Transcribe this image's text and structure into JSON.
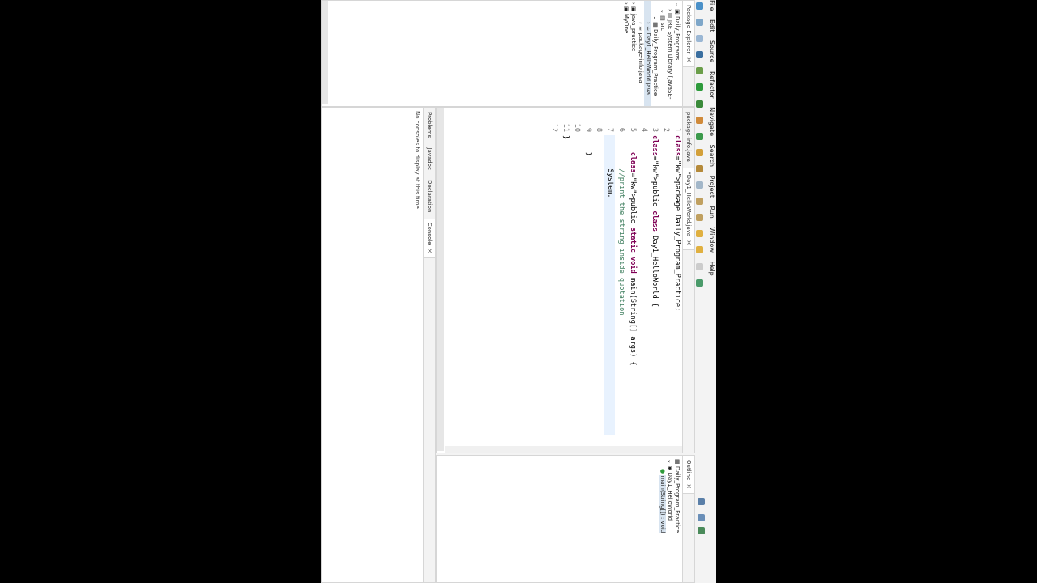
{
  "menu": [
    "File",
    "Edit",
    "Source",
    "Refactor",
    "Navigate",
    "Search",
    "Project",
    "Run",
    "Window",
    "Help"
  ],
  "package_explorer": {
    "title": "Package Explorer",
    "items": [
      {
        "label": "Daily_Programs",
        "indent": 0
      },
      {
        "label": "JRE System Library [JavaSE-",
        "indent": 1
      },
      {
        "label": "src",
        "indent": 1
      },
      {
        "label": "Daily_Program_Practice",
        "indent": 2
      },
      {
        "label": "Day1_HelloWorld.java",
        "indent": 3
      },
      {
        "label": "package-info.java",
        "indent": 3
      },
      {
        "label": "java_practice",
        "indent": 0
      },
      {
        "label": "MyOne",
        "indent": 0
      }
    ]
  },
  "editor": {
    "tabs": [
      "package-info.java",
      "*Day1_HelloWorld.java"
    ],
    "lines": [
      {
        "n": "1",
        "t": "package Daily_Program_Practice;"
      },
      {
        "n": "2",
        "t": ""
      },
      {
        "n": "3",
        "t": "public class Day1_HelloWorld {"
      },
      {
        "n": "4",
        "t": ""
      },
      {
        "n": "5",
        "t": "    public static void main(String[] args) {"
      },
      {
        "n": "6",
        "t": "        //print the string inside quotation"
      },
      {
        "n": "7",
        "t": "        System."
      },
      {
        "n": "8",
        "t": ""
      },
      {
        "n": "9",
        "t": "    }"
      },
      {
        "n": "10",
        "t": ""
      },
      {
        "n": "11",
        "t": "}"
      },
      {
        "n": "12",
        "t": ""
      }
    ]
  },
  "outline": {
    "title": "Outline",
    "items": [
      "Daily_Program_Practice",
      "Day1_HelloWorld",
      "main(String[]) : void"
    ]
  },
  "bottom_panel": {
    "tabs": [
      "Problems",
      "Javadoc",
      "Declaration",
      "Console"
    ],
    "message": "No consoles to display at this time."
  }
}
